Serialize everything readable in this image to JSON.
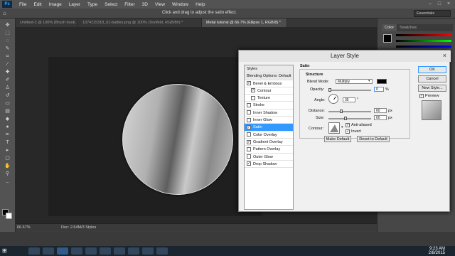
{
  "app": {
    "logo": "Ps"
  },
  "menu": [
    "File",
    "Edit",
    "Image",
    "Layer",
    "Type",
    "Select",
    "Filter",
    "3D",
    "View",
    "Window",
    "Help"
  ],
  "options_bar": {
    "hint": "Click and drag to adjust the satin effect.",
    "workspace": "Essentials"
  },
  "tabs": [
    "Untitled-2 @ 100% (Brush hook, RGB/16) *",
    "1374115318_01-battles.png @ 100% (Textfeld, RGB/8#) *",
    "Metal tutorial @ 66.7% (Ellipse 1, RGB/8) *"
  ],
  "status": {
    "zoom": "66.67%",
    "doc": "Doc: 2.64M/3 Styles"
  },
  "right_panel": {
    "tab_color": "Color",
    "tab_swatches": "Swatches"
  },
  "dialog": {
    "title": "Layer Style",
    "styles_header": "Styles",
    "styles": [
      {
        "label": "Blending Options: Default",
        "checkbox": false,
        "checked": false,
        "header": true
      },
      {
        "label": "Bevel & Emboss",
        "checkbox": true,
        "checked": true
      },
      {
        "label": "Contour",
        "checkbox": true,
        "checked": true,
        "indent": true
      },
      {
        "label": "Texture",
        "checkbox": true,
        "checked": false,
        "indent": true
      },
      {
        "label": "Stroke",
        "checkbox": true,
        "checked": false
      },
      {
        "label": "Inner Shadow",
        "checkbox": true,
        "checked": false
      },
      {
        "label": "Inner Glow",
        "checkbox": true,
        "checked": false
      },
      {
        "label": "Satin",
        "checkbox": true,
        "checked": true,
        "selected": true
      },
      {
        "label": "Color Overlay",
        "checkbox": true,
        "checked": false
      },
      {
        "label": "Gradient Overlay",
        "checkbox": true,
        "checked": true
      },
      {
        "label": "Pattern Overlay",
        "checkbox": true,
        "checked": false
      },
      {
        "label": "Outer Glow",
        "checkbox": true,
        "checked": false
      },
      {
        "label": "Drop Shadow",
        "checkbox": true,
        "checked": true
      }
    ],
    "satin": {
      "section": "Satin",
      "group": "Structure",
      "blend_mode_label": "Blend Mode:",
      "blend_mode_value": "Multiply",
      "blend_color": "#000000",
      "opacity_label": "Opacity:",
      "opacity_value": "0",
      "opacity_unit": "%",
      "angle_label": "Angle:",
      "angle_value": "35",
      "angle_unit": "°",
      "distance_label": "Distance:",
      "distance_value": "60",
      "distance_unit": "px",
      "size_label": "Size:",
      "size_value": "60",
      "size_unit": "px",
      "contour_label": "Contour:",
      "anti_aliased_label": "Anti-aliased",
      "invert_label": "Invert",
      "make_default": "Make Default",
      "reset_default": "Reset to Default"
    },
    "buttons": {
      "ok": "OK",
      "cancel": "Cancel",
      "new_style": "New Style...",
      "preview": "Preview"
    }
  },
  "taskbar": {
    "time": "9:23 AM",
    "date": "2/8/2015"
  }
}
